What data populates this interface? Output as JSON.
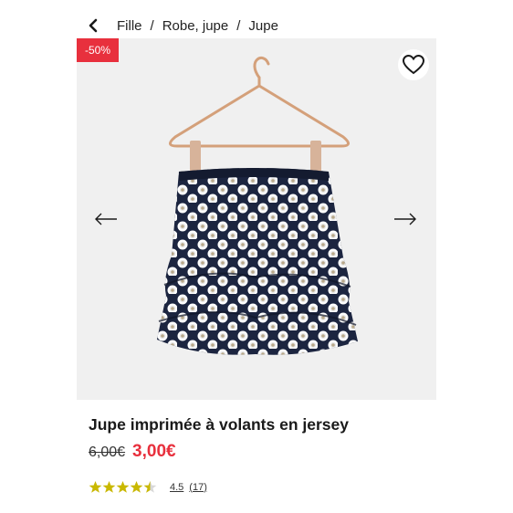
{
  "breadcrumb": {
    "items": [
      "Fille",
      "Robe, jupe",
      "Jupe"
    ],
    "separator": "/"
  },
  "product": {
    "discount_badge": "-50%",
    "title": "Jupe imprimée à volants en jersey",
    "old_price": "6,00€",
    "new_price": "3,00€",
    "rating_value": "4.5",
    "rating_count": "(17)",
    "rating_stars": 4.5
  },
  "icons": {
    "back": "chevron-left-icon",
    "favorite": "heart-outline-icon",
    "prev": "arrow-left-icon",
    "next": "arrow-right-icon",
    "star": "star-icon"
  },
  "colors": {
    "accent_red": "#e8303d",
    "star_gold": "#c9b800",
    "skirt_navy": "#1c2540",
    "hanger_copper": "#d4a07a"
  }
}
